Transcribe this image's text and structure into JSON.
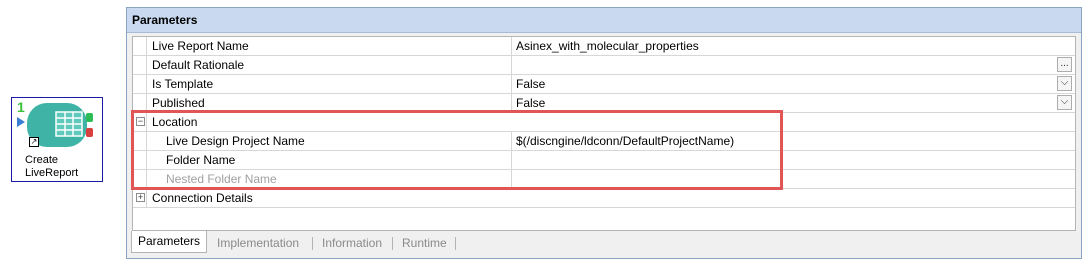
{
  "node": {
    "count": "1",
    "label_line1": "Create",
    "label_line2": "LiveReport",
    "shortcut_glyph": "↗"
  },
  "panel": {
    "title": "Parameters",
    "rows": [
      {
        "name": "Live Report Name",
        "value": "Asinex_with_molecular_properties"
      },
      {
        "name": "Default Rationale",
        "value": "",
        "button": "..."
      },
      {
        "name": "Is Template",
        "value": "False",
        "button": "⌵"
      },
      {
        "name": "Published",
        "value": "False",
        "button": "⌵"
      },
      {
        "name": "Location",
        "expander": "−"
      },
      {
        "name": "Live Design Project Name",
        "value": "$(/discngine/ldconn/DefaultProjectName)"
      },
      {
        "name": "Folder Name",
        "value": ""
      },
      {
        "name": "Nested Folder Name",
        "value": ""
      },
      {
        "name": "Connection Details",
        "expander": "+"
      }
    ],
    "tabs": [
      "Parameters",
      "Implementation",
      "Information",
      "Runtime"
    ]
  },
  "colors": {
    "highlight_box": "#e05555",
    "title_bar": "#c9daf0",
    "node_body": "#3fb4a6"
  }
}
